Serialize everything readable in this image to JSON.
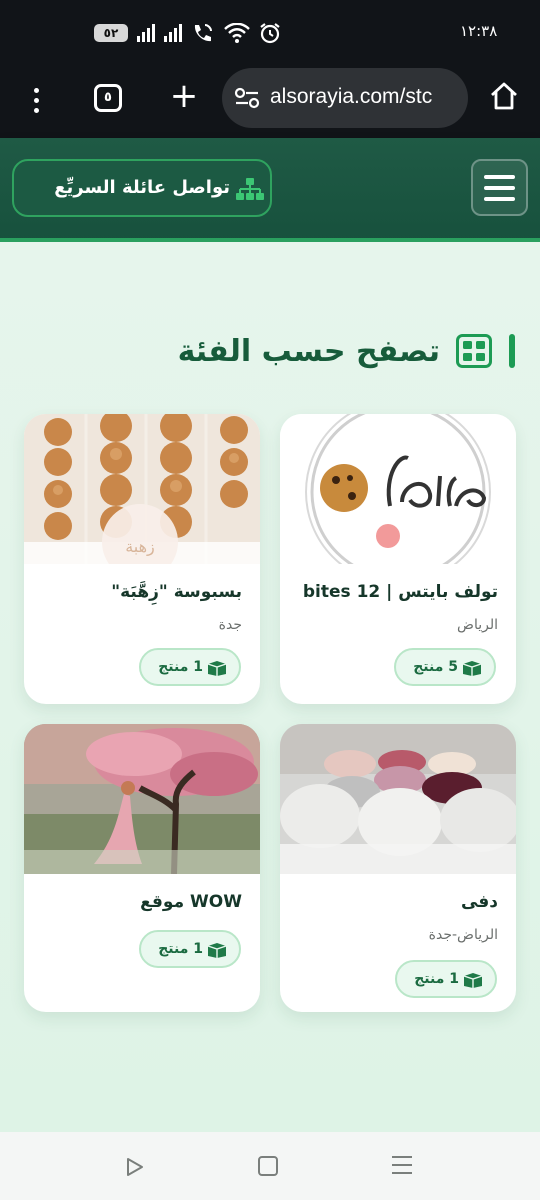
{
  "status_bar": {
    "time": "١٢:٣٨",
    "battery": "٥٢",
    "icons": [
      "battery-icon",
      "signal-icon",
      "signal-icon",
      "wifi-calling-icon",
      "wifi-icon",
      "alarm-icon"
    ]
  },
  "browser": {
    "tab_count": "٥",
    "url": "alsorayia.com/stc",
    "icons": [
      "menu-dots-icon",
      "tabs-icon",
      "new-tab-icon",
      "site-settings-icon",
      "home-icon"
    ]
  },
  "header": {
    "family_button_label": "تواصل عائلة السريِّع",
    "icons": [
      "sitemap-icon",
      "hamburger-icon"
    ]
  },
  "section": {
    "title": "تصفح حسب الفئة",
    "icon": "grid-icon"
  },
  "categories": [
    {
      "name": "تولف بايتس | 12 bites",
      "city": "الرياض",
      "count": "5 منتج",
      "logo_text": "12 bites",
      "icon": "box-icon"
    },
    {
      "name": "بسبوسة \"زِهَّبَة\"",
      "city": "جدة",
      "count": "1 منتج",
      "logo_text": "زهبة",
      "icon": "box-icon"
    },
    {
      "name": "دفى",
      "city": "الرياض-جدة",
      "count": "1 منتج",
      "icon": "box-icon"
    },
    {
      "name": "WOW موقع",
      "city": "",
      "count": "1 منتج",
      "icon": "box-icon"
    }
  ],
  "colors": {
    "header_bg": "#1f5a45",
    "accent": "#1d9b54",
    "title": "#175c3b",
    "page_bg": "#e3f4ea"
  },
  "nav_bar": {
    "icons": [
      "back-icon",
      "home-icon",
      "recent-apps-icon"
    ]
  }
}
